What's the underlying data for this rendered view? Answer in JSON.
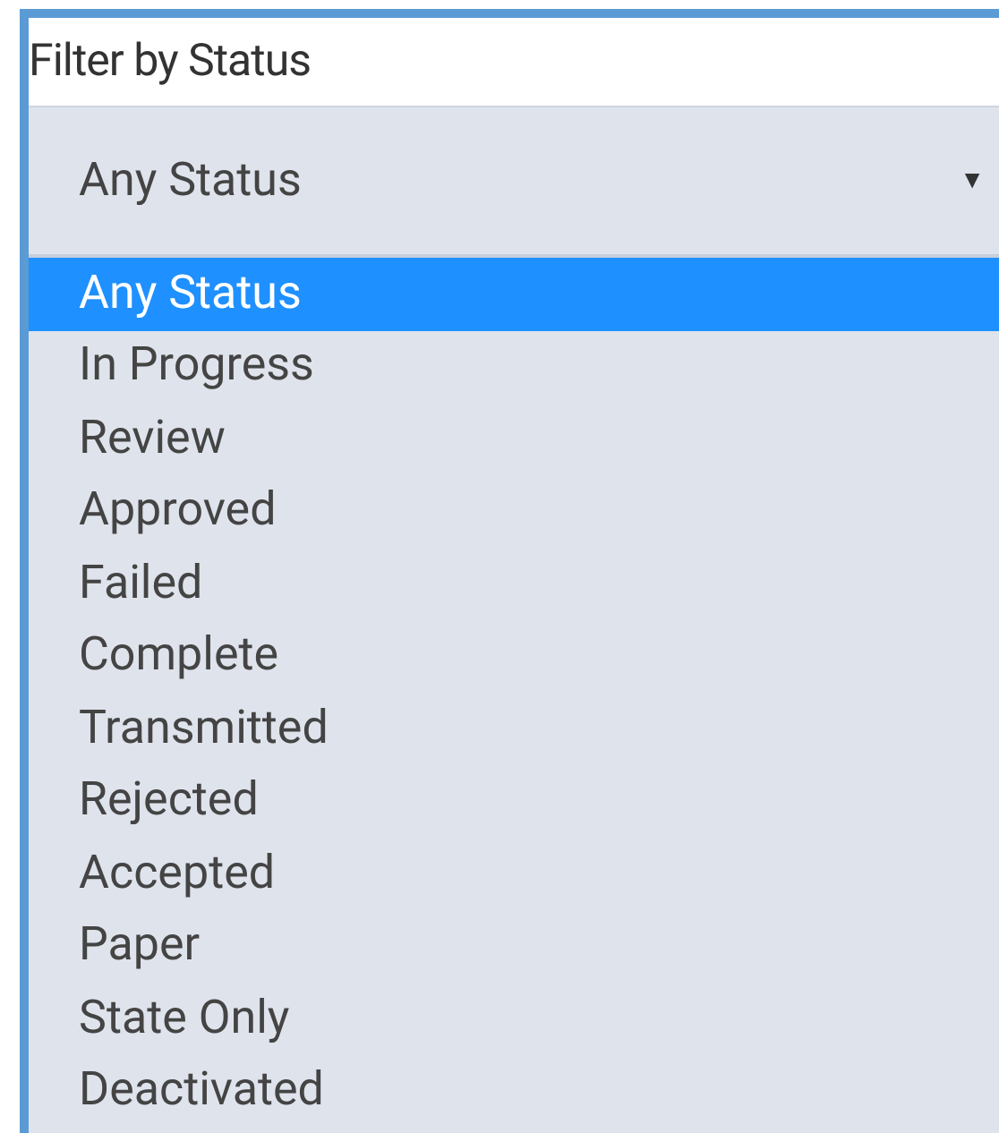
{
  "filter": {
    "title": "Filter by Status",
    "select": {
      "value": "Any Status",
      "caret": "▼"
    },
    "options": [
      {
        "label": "Any Status",
        "selected": true
      },
      {
        "label": "In Progress",
        "selected": false
      },
      {
        "label": "Review",
        "selected": false
      },
      {
        "label": "Approved",
        "selected": false
      },
      {
        "label": "Failed",
        "selected": false
      },
      {
        "label": "Complete",
        "selected": false
      },
      {
        "label": "Transmitted",
        "selected": false
      },
      {
        "label": "Rejected",
        "selected": false
      },
      {
        "label": "Accepted",
        "selected": false
      },
      {
        "label": "Paper",
        "selected": false
      },
      {
        "label": "State Only",
        "selected": false
      },
      {
        "label": "Deactivated",
        "selected": false
      }
    ]
  }
}
